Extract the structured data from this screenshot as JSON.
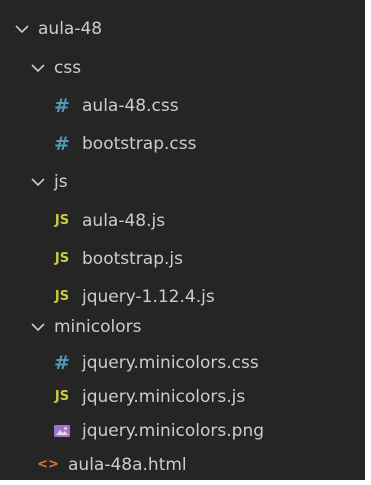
{
  "explorer": {
    "root": {
      "label": "aula-48",
      "children": {
        "css": {
          "label": "css",
          "files": [
            "aula-48.css",
            "bootstrap.css"
          ]
        },
        "js": {
          "label": "js",
          "files": [
            "aula-48.js",
            "bootstrap.js",
            "jquery-1.12.4.js"
          ]
        },
        "minicolors": {
          "label": "minicolors",
          "files": [
            "jquery.minicolors.css",
            "jquery.minicolors.js",
            "jquery.minicolors.png"
          ]
        },
        "html_file": "aula-48a.html"
      }
    },
    "icons": {
      "folder_open": "chevron-down-icon",
      "css": "css-hash-icon",
      "js": "js-file-icon",
      "png": "image-file-icon",
      "html": "html-brackets-icon"
    },
    "icon_glyphs": {
      "css": "#",
      "js": "JS",
      "html": "<>"
    },
    "colors": {
      "background": "#252526",
      "text": "#cccccc",
      "css_icon": "#519aba",
      "js_icon": "#cbcb41",
      "html_icon": "#e37933",
      "image_icon": "#a074c4"
    }
  }
}
